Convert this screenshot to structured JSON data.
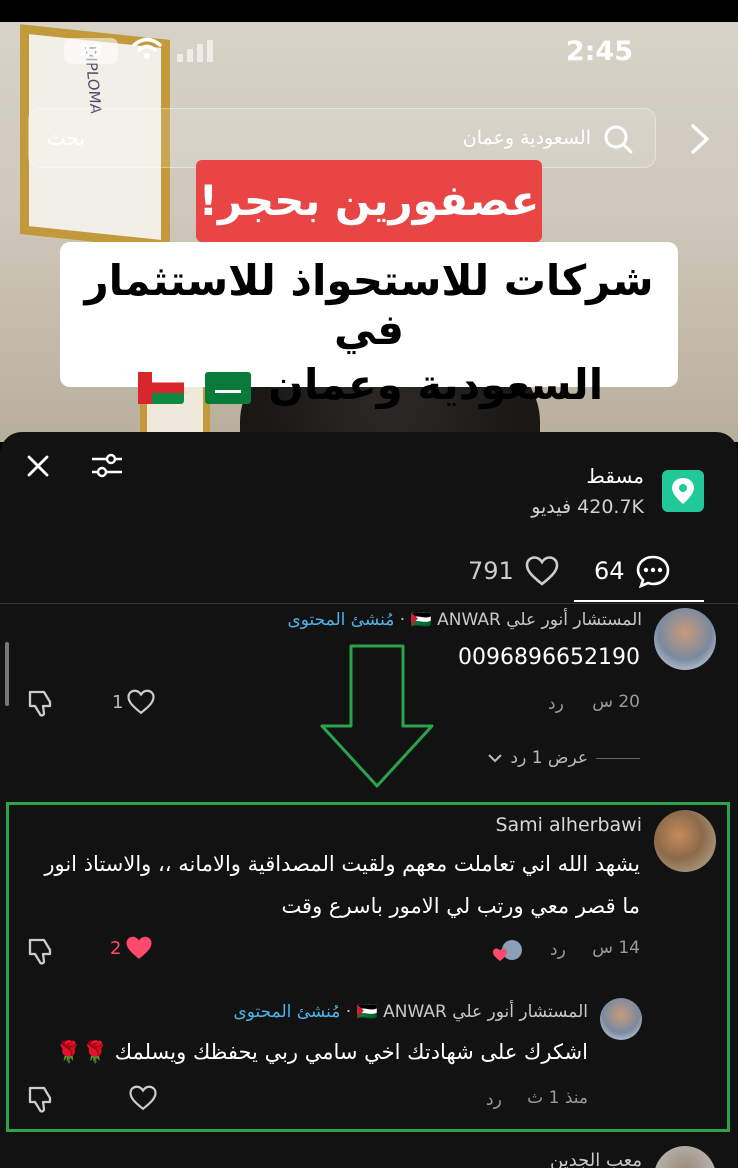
{
  "status_bar": {
    "time": "2:45",
    "battery": "23"
  },
  "search": {
    "query": "السعودية وعمان",
    "button_label": "بحث"
  },
  "video": {
    "banner_red": "عصفورين بحجر!",
    "banner_line1": "شركات للاستحواذ للاستثمار في",
    "banner_line2": "السعودية وعمان",
    "frame_text": "DIPLOMA"
  },
  "sheet": {
    "location_title": "مسقط",
    "location_count": "420.7K فيديو",
    "tabs": {
      "comments_count": "64",
      "likes_count": "791"
    }
  },
  "comments": [
    {
      "author": "المستشار أنور علي 🇵🇸 ANWAR",
      "creator_badge": "مُنشئ المحتوى",
      "text": "0096896652190",
      "time": "20 س",
      "reply": "رد",
      "likes": "1",
      "view_replies": "عرض 1 رد"
    },
    {
      "author": "Sami alherbawi",
      "text_line1": "يشهد الله اني تعاملت معهم ولقيت المصداقية والامانه ،، والاستاذ انور",
      "text_line2": "ما قصر معي ورتب لي الامور باسرع وقت",
      "time": "14 س",
      "reply": "رد",
      "likes": "2"
    },
    {
      "author": "المستشار أنور علي 🇵🇸 ANWAR",
      "creator_badge": "مُنشئ المحتوى",
      "text": "اشكرك على شهادتك اخي سامي ربي يحفظك ويسلمك 🌹🌹",
      "time": "منذ 1 ث",
      "reply": "رد"
    },
    {
      "author": "معب الجدين"
    }
  ],
  "colors": {
    "sheet_bg": "#121212",
    "creator_blue": "#4fb3e8",
    "like_red": "#ff4a6b",
    "highlight_green": "#2aa34a",
    "location_green": "#20c997",
    "banner_red": "#e94545"
  }
}
